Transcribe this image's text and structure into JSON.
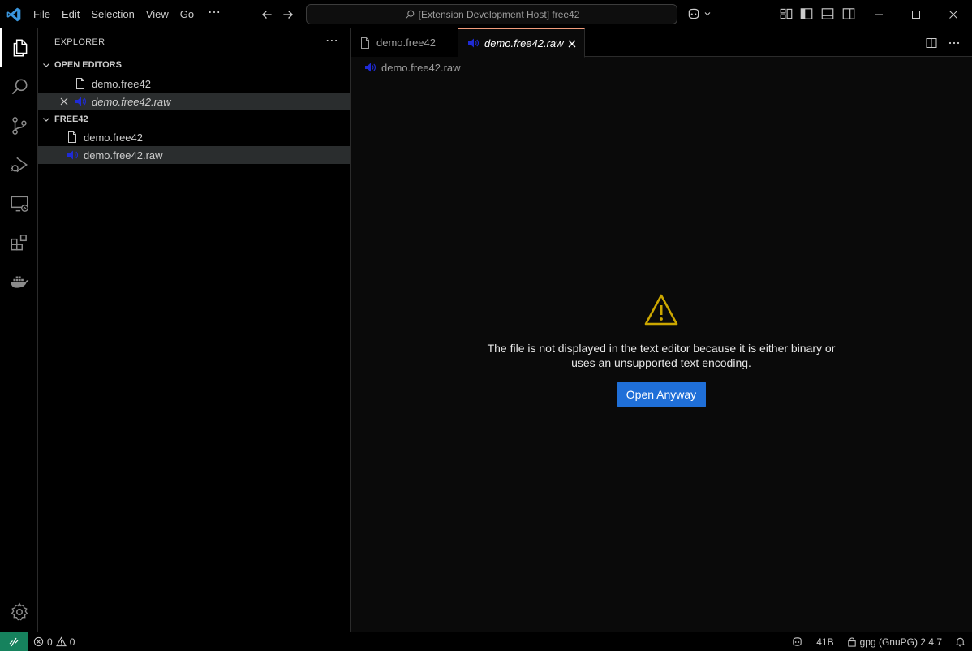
{
  "titlebar": {
    "menu": [
      "File",
      "Edit",
      "Selection",
      "View",
      "Go"
    ],
    "more": "⋯",
    "command_center": "[Extension Development Host] free42"
  },
  "activity_bar": {
    "items": [
      "explorer-icon",
      "search-icon",
      "source-control-icon",
      "run-debug-icon",
      "remote-explorer-icon",
      "extensions-icon",
      "docker-icon"
    ],
    "bottom": "manage-gear-icon"
  },
  "sidebar": {
    "title": "EXPLORER",
    "more": "⋯",
    "open_editors": {
      "header": "OPEN EDITORS",
      "items": [
        {
          "label": "demo.free42",
          "icon": "file-icon"
        },
        {
          "label": "demo.free42.raw",
          "icon": "audio-file-icon",
          "selected": true
        }
      ]
    },
    "folder": {
      "header": "FREE42",
      "items": [
        {
          "label": "demo.free42",
          "icon": "file-icon"
        },
        {
          "label": "demo.free42.raw",
          "icon": "audio-file-icon",
          "selected": true
        }
      ]
    }
  },
  "editor": {
    "tabs": [
      {
        "label": "demo.free42",
        "active": false
      },
      {
        "label": "demo.free42.raw",
        "active": true
      }
    ],
    "breadcrumb": "demo.free42.raw",
    "message_line1": "The file is not displayed in the text editor because it is either binary or",
    "message_line2": "uses an unsupported text encoding.",
    "button": "Open Anyway"
  },
  "statusbar": {
    "errors": "0",
    "warnings": "0",
    "size": "41B",
    "gpg": "gpg (GnuPG) 2.4.7"
  },
  "colors": {
    "accent_button": "#1f6fd8",
    "warning": "#cca700",
    "remote": "#16825d",
    "audio_icon": "#1f2bd6",
    "active_tab_border": "#f29c7c"
  }
}
